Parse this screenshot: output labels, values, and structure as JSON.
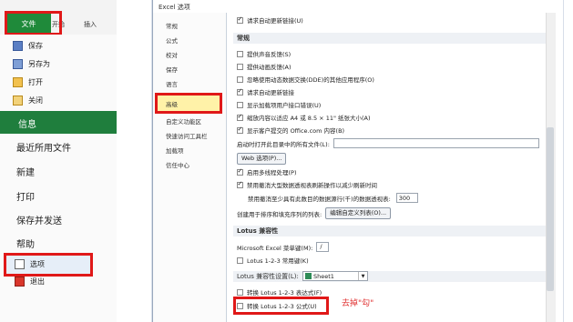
{
  "backstage": {
    "tabs": {
      "file": "文件",
      "start": "开始",
      "insert": "插入"
    },
    "menu_small": [
      {
        "label": "保存",
        "icon": "save-icon"
      },
      {
        "label": "另存为",
        "icon": "save-as-icon"
      },
      {
        "label": "打开",
        "icon": "open-folder-icon"
      },
      {
        "label": "关闭",
        "icon": "close-file-icon"
      }
    ],
    "info": "信息",
    "menu_large": [
      "最近所用文件",
      "新建",
      "打印",
      "保存并发送",
      "帮助"
    ],
    "options": "选项",
    "exit": "退出"
  },
  "dialog": {
    "title": "Excel 选项",
    "nav": [
      "常规",
      "公式",
      "校对",
      "保存",
      "语言",
      "高级",
      "自定义功能区",
      "快速访问工具栏",
      "加载项",
      "信任中心"
    ],
    "top_item": "请求自动更新链接(U)",
    "general_header": "常规",
    "general": [
      {
        "label": "提供声音反馈(S)",
        "checked": false
      },
      {
        "label": "提供动画反馈(A)",
        "checked": false
      },
      {
        "label": "忽略使用动态数据交换(DDE)的其他应用程序(O)",
        "checked": false
      },
      {
        "label": "请求自动更新链接",
        "checked": true
      },
      {
        "label": "显示加载项用户接口错误(U)",
        "checked": false
      },
      {
        "label": "缩放内容以适应 A4 或 8.5 × 11\" 纸张大小(A)",
        "checked": true
      },
      {
        "label": "显示客户提交的 Office.com 内容(B)",
        "checked": true
      }
    ],
    "startup_label": "启动时打开此目录中的所有文件(L):",
    "web_options": "Web 选项(P)...",
    "multithread": "启用多线程处理(P)",
    "undo_label": "禁用撤消大型数据透视表刷新操作以减少刷新时间",
    "undo_rows_label": "禁用撤消至少具有此数目的数据源行(千)的数据透视表:",
    "undo_rows_value": "300",
    "custom_list_label": "创建用于排序和填充序列的列表:",
    "custom_list_button": "编辑自定义列表(O)...",
    "lotus_header": "Lotus 兼容性",
    "menu_key_label": "Microsoft Excel 菜单键(M):",
    "menu_key_value": "/",
    "lotus_nav": "Lotus 1-2-3 常用键(K)",
    "lotus_settings_header": "Lotus 兼容性设置(L):",
    "sheet_value": "Sheet1",
    "transition_eval": "转换 Lotus 1-2-3 表达式(F)",
    "transition_formula": "转换 Lotus 1-2-3 公式(U)",
    "annotation": "去掉\"勾\""
  }
}
